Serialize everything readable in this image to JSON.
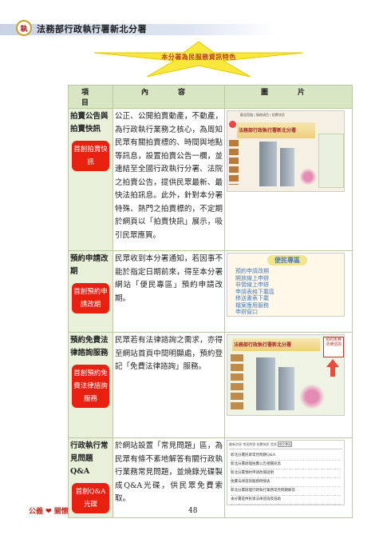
{
  "header": {
    "title": "法務部行政執行署新北分署",
    "logo_text": "執"
  },
  "banner": {
    "text": "本分署為民服務資訊特色"
  },
  "table": {
    "headers": [
      "項　目",
      "內　容",
      "圖　片"
    ],
    "rows": [
      {
        "item": "拍賣公告與拍賣快訊",
        "badge": "首創拍賣快訊",
        "desc": "公正、公開拍賣動產，不動產，為行政執行業務之核心，為周知民眾有關拍賣標的、時間與地點等訊息，設置拍賣公告一欄，並連結至全國行政執行分署、法院之拍賣公告，提供民眾最新、最快法拍訊息。此外，針對本分署特殊、熱門之拍賣標的，不定期於網頁以「拍賣快訊」展示，吸引民眾應買。"
      },
      {
        "item": "預約申請改期",
        "badge": "首創預約申請改期",
        "desc": "民眾收到本分署通知，若因事不能於指定日期前來，得至本分署網站「便民專區」預約申請改期。"
      },
      {
        "item": "預約免費法律諮詢服務",
        "badge": "首創預約免費法律諮詢服務",
        "desc": "民眾若有法律諮詢之需求，亦得至網站首頁中間明顯處，預約登記「免費法律諮詢」服務。"
      },
      {
        "item": "行政執行常見問題Q&A",
        "badge": "首創Q&A光碟",
        "desc": "於網站設置「常見問題」區，為民眾有條不紊地解答有關行政執行業務常見問題，並燒錄光碟製成Q&A光碟，供民眾免費索取。"
      }
    ]
  },
  "screens": {
    "s1_title": "法務部行政執行署新北分署",
    "s1_ribbon": "歡迎蒞臨 | 服務項目 | 拍賣快訊",
    "s2_title": "便民專區",
    "s2_items": [
      "預約申請改期",
      "開放線上申辦",
      "非營線上申辦",
      "申請表格下載區",
      "移送書表下載",
      "檔案應用服務",
      "申辦窗口"
    ],
    "s3_title": "法務部行政執行署新北分署",
    "s3_sign": "預約免費法律諮詢",
    "s4_tabs": [
      "最新消息",
      "常見問答",
      "拍賣快訊",
      "首頁",
      "便民專區"
    ],
    "s4_rows": [
      "新北分署民眾常見問題Q&A",
      "新北分署辦理拍賣公告相關訊息",
      "新北分署預約申請改期說明",
      "免費法律諮詢服務時間表",
      "新北分署辦理行政執行業務常見問題解答",
      "本分署提供民眾法律諮詢及協助"
    ]
  },
  "footer": {
    "left_text1": "公義",
    "heart": "❤",
    "left_text2": "關懷",
    "page": "48"
  }
}
